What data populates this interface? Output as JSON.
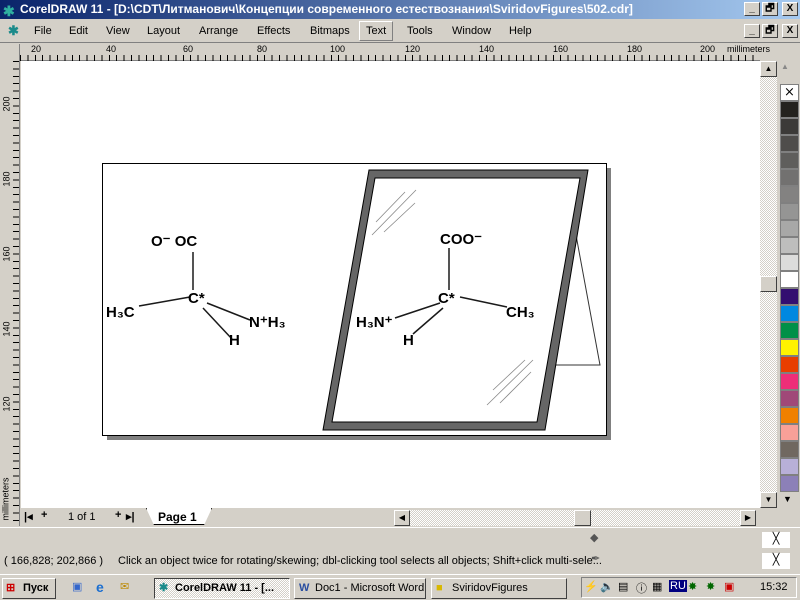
{
  "window": {
    "title": "CorelDRAW 11 - [D:\\CDT\\Литманович\\Концепции современного естествознания\\SviridovFigures\\502.cdr]",
    "buttons": [
      "_",
      "🗗",
      "X"
    ]
  },
  "menu": [
    "File",
    "Edit",
    "View",
    "Layout",
    "Arrange",
    "Effects",
    "Bitmaps",
    "Text",
    "Tools",
    "Window",
    "Help"
  ],
  "ruler": {
    "h_labels": [
      "20",
      "40",
      "60",
      "80",
      "100",
      "120",
      "140",
      "160",
      "180",
      "200"
    ],
    "v_labels": [
      "200",
      "180",
      "160",
      "140",
      "120"
    ],
    "unit": "millimeters"
  },
  "drawing": {
    "left": {
      "top": "O⁻ OC",
      "center": "C*",
      "left": "H₃C",
      "right": "N⁺H₃",
      "bottom": "H"
    },
    "right": {
      "top": "COO⁻",
      "center": "C*",
      "left": "H₃N⁺",
      "right": "CH₃",
      "bottom": "H"
    }
  },
  "palette": [
    "#24221e",
    "#3c3a38",
    "#4f4d4b",
    "#5f5e5c",
    "#727170",
    "#838281",
    "#959594",
    "#a8a8a7",
    "#bebebd",
    "#dcdcdb",
    "#ffffff",
    "#330e70",
    "#0088e0",
    "#009048",
    "#fff200",
    "#e83e00",
    "#ee2e78",
    "#a04878",
    "#f08000",
    "#f8a098",
    "#706860",
    "#b8b0d8",
    "#8c80b8"
  ],
  "pages": {
    "counter": "1 of 1",
    "tab": "Page 1"
  },
  "status": {
    "coords": "( 166,828; 202,866 )",
    "hint": "Click an object twice for rotating/skewing; dbl-clicking tool selects all objects; Shift+click multi-sele..."
  },
  "taskbar": {
    "start": "Пуск",
    "tasks": [
      "CorelDRAW 11 - [...",
      "Doc1 - Microsoft Word",
      "SviridovFigures"
    ],
    "lang": "RU",
    "clock": "15:32"
  }
}
